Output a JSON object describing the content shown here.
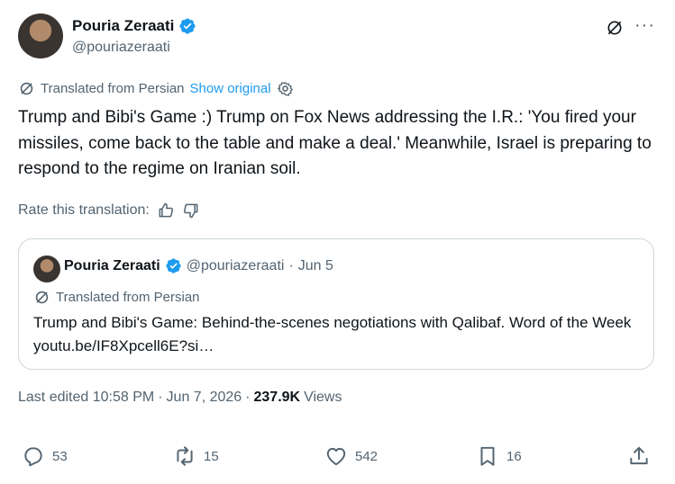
{
  "author": {
    "name": "Pouria Zeraati",
    "handle": "@pouriazeraati"
  },
  "translation": {
    "label": "Translated from Persian",
    "show_original": "Show original",
    "rate_label": "Rate this translation:"
  },
  "tweet": {
    "text": "Trump and Bibi's Game :) Trump on Fox News addressing the I.R.: 'You fired your missiles, come back to the table and make a deal.' Meanwhile, Israel is preparing to respond to the regime on Iranian soil."
  },
  "quote": {
    "name": "Pouria Zeraati",
    "handle": "@pouriazeraati",
    "separator": "·",
    "date": "Jun 5",
    "translation_label": "Translated from Persian",
    "text": "Trump and Bibi's Game: Behind-the-scenes negotiations with Qalibaf. Word of the Week youtu.be/IF8Xpcell6E?si…"
  },
  "meta": {
    "edited": "Last edited 10:58 PM",
    "sep1": "·",
    "date": "Jun 7, 2026",
    "sep2": "·",
    "views_count": "237.9K",
    "views_label": "Views"
  },
  "actions": {
    "replies": "53",
    "reposts": "15",
    "likes": "542",
    "bookmarks": "16"
  },
  "colors": {
    "accent": "#1d9bf0",
    "muted": "#536471",
    "text": "#0f1419",
    "border": "#cfd9de"
  }
}
